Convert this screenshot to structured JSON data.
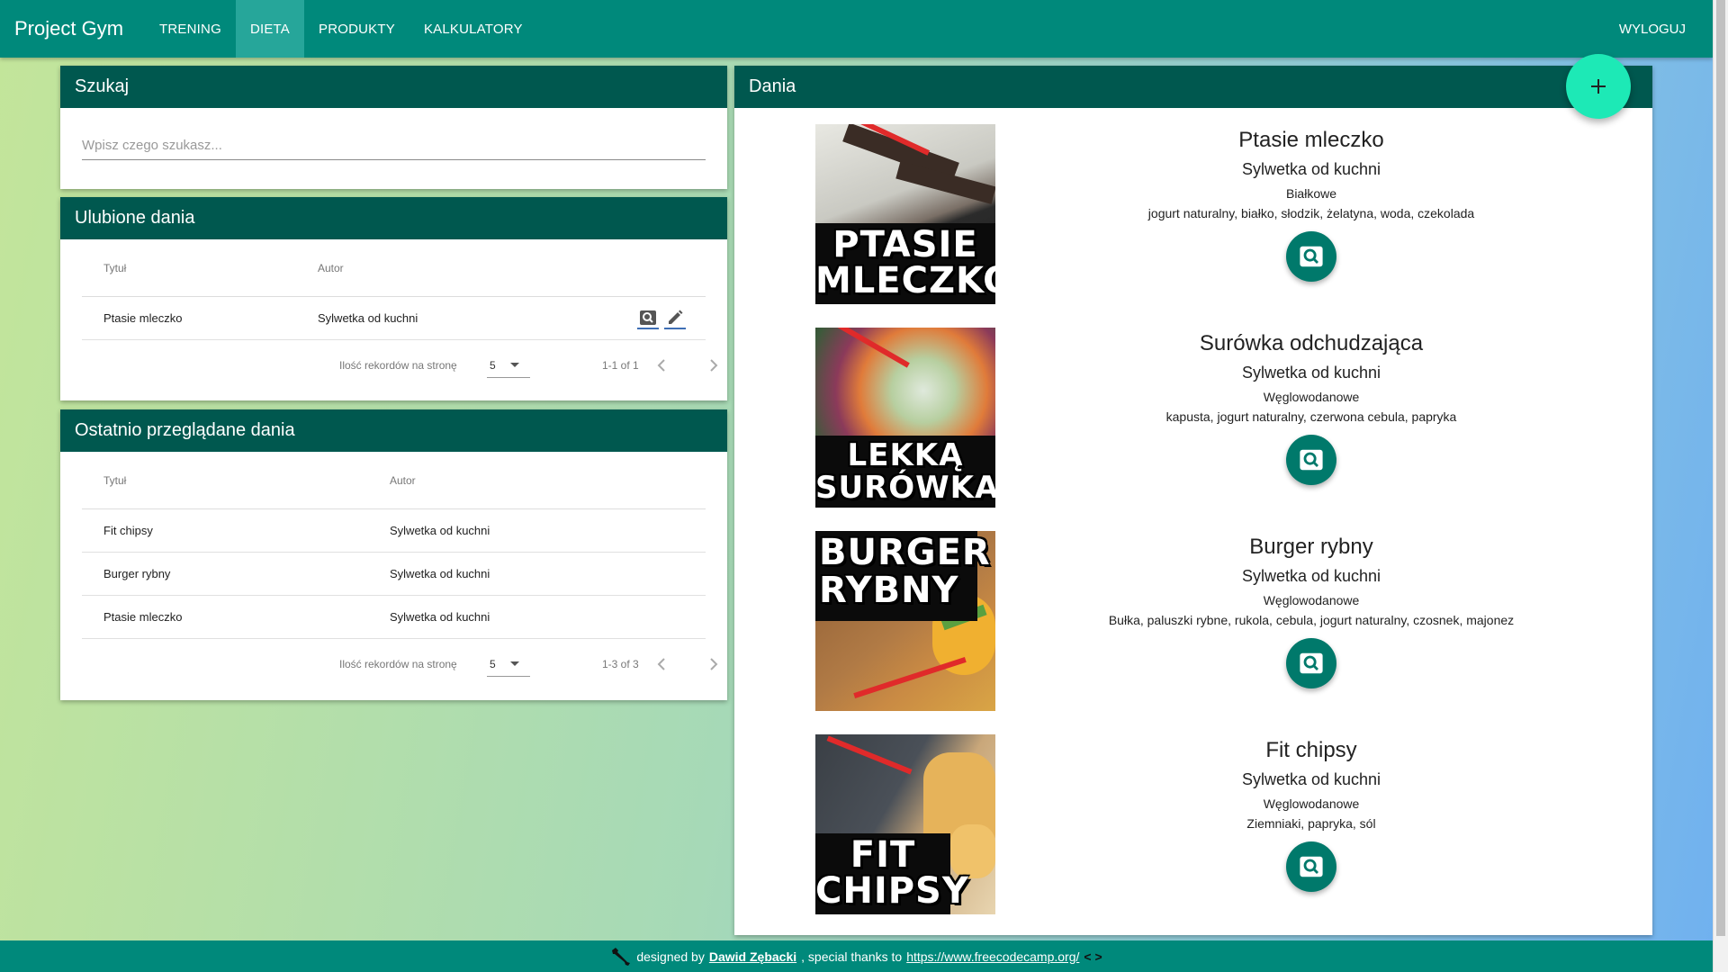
{
  "nav": {
    "brand": "Project Gym",
    "items": [
      "TRENING",
      "DIETA",
      "PRODUKTY",
      "KALKULATORY"
    ],
    "active": "DIETA",
    "logout": "WYLOGUJ"
  },
  "search": {
    "title": "Szukaj",
    "placeholder": "Wpisz czego szukasz..."
  },
  "favorites": {
    "title": "Ulubione dania",
    "columns": [
      "Tytuł",
      "Autor"
    ],
    "rows": [
      {
        "title": "Ptasie mleczko",
        "author": "Sylwetka od kuchni"
      }
    ],
    "pager": {
      "label": "Ilość rekordów na stronę",
      "per_page": "5",
      "range": "1-1 of 1"
    }
  },
  "recent": {
    "title": "Ostatnio przeglądane dania",
    "columns": [
      "Tytuł",
      "Autor"
    ],
    "rows": [
      {
        "title": "Fit chipsy",
        "author": "Sylwetka od kuchni"
      },
      {
        "title": "Burger rybny",
        "author": "Sylwetka od kuchni"
      },
      {
        "title": "Ptasie mleczko",
        "author": "Sylwetka od kuchni"
      }
    ],
    "pager": {
      "label": "Ilość rekordów na stronę",
      "per_page": "5",
      "range": "1-3 of 3"
    }
  },
  "dishes": {
    "title": "Dania",
    "add_icon": "plus-icon",
    "items": [
      {
        "name": "Ptasie mleczko",
        "author": "Sylwetka od kuchni",
        "category": "Białkowe",
        "ingredients": "jogurt naturalny, białko, słodzik, żelatyna, woda, czekolada",
        "image_caption": [
          "PTASIE",
          "MLECZKO"
        ]
      },
      {
        "name": "Surówka odchudzająca",
        "author": "Sylwetka od kuchni",
        "category": "Węglowodanowe",
        "ingredients": "kapusta, jogurt naturalny, czerwona cebula, papryka",
        "image_caption": [
          "LEKKĄ",
          "SURÓWKA"
        ]
      },
      {
        "name": "Burger rybny",
        "author": "Sylwetka od kuchni",
        "category": "Węglowodanowe",
        "ingredients": "Bułka, paluszki rybne, rukola, cebula, jogurt naturalny, czosnek, majonez",
        "image_caption": [
          "BURGER",
          "RYBNY"
        ]
      },
      {
        "name": "Fit chipsy",
        "author": "Sylwetka od kuchni",
        "category": "Węglowodanowe",
        "ingredients": "Ziemniaki, papryka, sól",
        "image_caption": [
          "FIT",
          "CHIPSY"
        ]
      }
    ]
  },
  "footer": {
    "prefix": "designed by",
    "author": "Dawid Zębacki",
    "middle": ", special thanks to",
    "link": "https://www.freecodecamp.org/",
    "code_icon": "< >"
  },
  "colors": {
    "nav": "#00897b",
    "nav_active": "#26a69a",
    "card_header": "#00584f",
    "fab": "#1de9b6",
    "dish_button": "#00796b"
  }
}
